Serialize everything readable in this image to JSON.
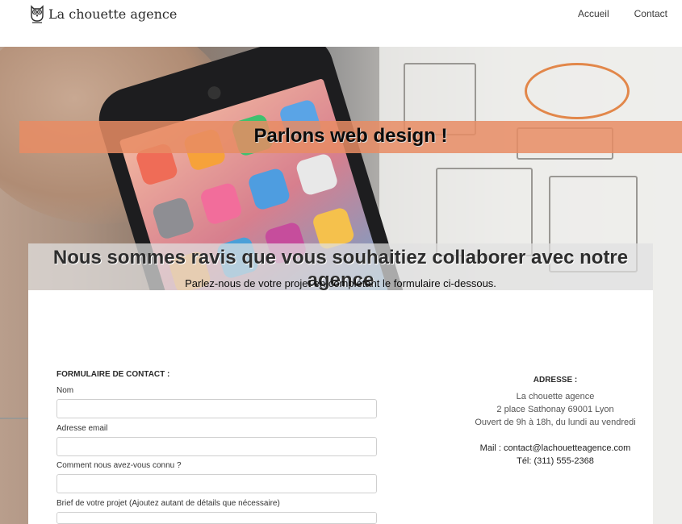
{
  "header": {
    "brand": "La chouette agence",
    "nav": [
      {
        "label": "Accueil"
      },
      {
        "label": "Contact"
      }
    ]
  },
  "hero": {
    "title": "Parlons web design !"
  },
  "intro": {
    "title": "Nous sommes ravis que vous souhaitiez collaborer avec notre agence",
    "subtitle": "Parlez-nous de votre projet en complétant le formulaire ci-dessous."
  },
  "form": {
    "title": "FORMULAIRE DE CONTACT :",
    "fields": [
      {
        "label": "Nom",
        "value": ""
      },
      {
        "label": "Adresse email",
        "value": ""
      },
      {
        "label": "Comment nous avez-vous connu ?",
        "value": ""
      },
      {
        "label": "Brief de votre projet (Ajoutez autant de détails que nécessaire)",
        "value": ""
      }
    ]
  },
  "address": {
    "title": "ADRESSE :",
    "lines": [
      "La chouette agence",
      "2 place Sathonay 69001 Lyon",
      "Ouvert de 9h à 18h, du lundi au vendredi"
    ],
    "mail": "Mail : contact@lachouetteagence.com",
    "phone": "Tél: (311) 555-2368"
  },
  "colors": {
    "hero_band": "#e78c64",
    "intro_band": "#e1e1e1",
    "text_dark": "#2a2a2a"
  },
  "icons": {
    "logo": "owl-icon"
  }
}
